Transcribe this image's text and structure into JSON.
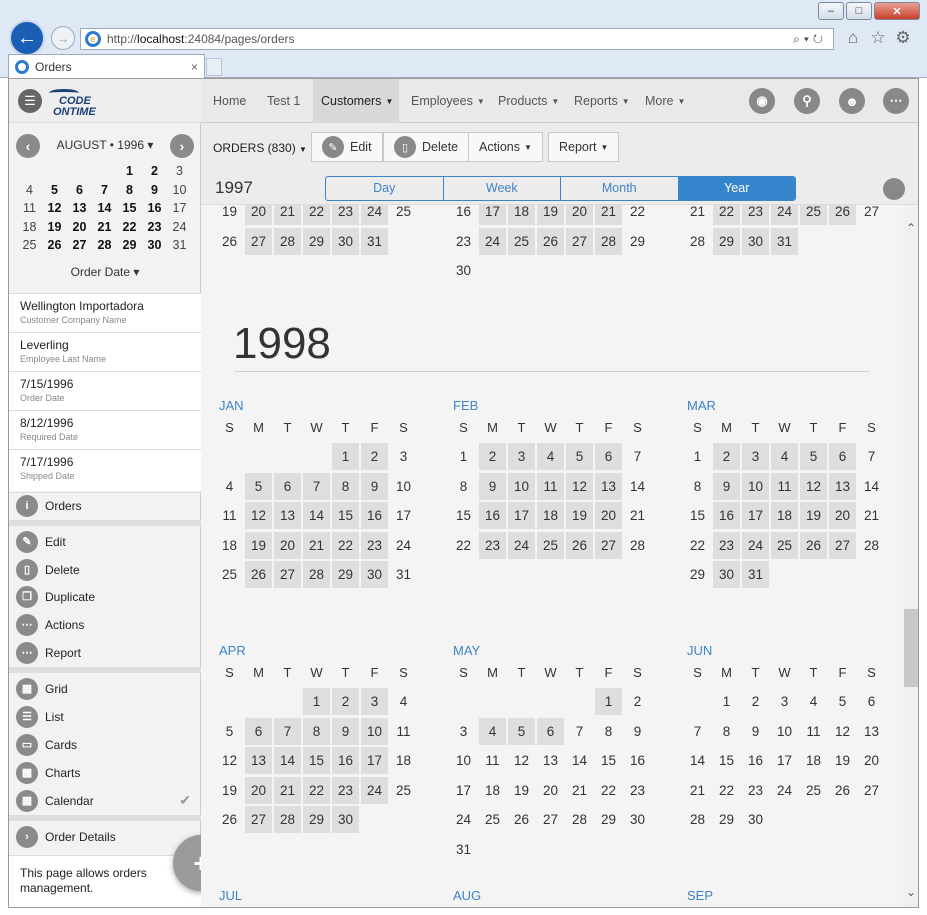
{
  "browser": {
    "url_prefix": "http://",
    "url_host": "localhost",
    "url_rest": ":24084/pages/orders",
    "tab_title": "Orders",
    "window_buttons": [
      "–",
      "□",
      "✕"
    ]
  },
  "sidebar": {
    "mini_calendar": {
      "title": "AUGUST • 1996 ▾",
      "weeks": [
        [
          " ",
          " ",
          " ",
          " ",
          "1",
          "2",
          "3"
        ],
        [
          "4",
          "5",
          "6",
          "7",
          "8",
          "9",
          "10"
        ],
        [
          "11",
          "12",
          "13",
          "14",
          "15",
          "16",
          "17"
        ],
        [
          "18",
          "19",
          "20",
          "21",
          "22",
          "23",
          "24"
        ],
        [
          "25",
          "26",
          "27",
          "28",
          "29",
          "30",
          "31"
        ]
      ],
      "bold_days": [
        "1",
        "2",
        "5",
        "6",
        "7",
        "8",
        "9",
        "12",
        "13",
        "14",
        "15",
        "16",
        "19",
        "20",
        "21",
        "22",
        "23",
        "26",
        "27",
        "28",
        "29",
        "30"
      ],
      "footer": "Order Date ▾"
    },
    "fields": [
      {
        "value": "Wellington Importadora",
        "label": "Customer Company Name"
      },
      {
        "value": "Leverling",
        "label": "Employee Last Name"
      },
      {
        "value": "7/15/1996",
        "label": "Order Date"
      },
      {
        "value": "8/12/1996",
        "label": "Required Date"
      },
      {
        "value": "7/17/1996",
        "label": "Shipped Date"
      }
    ],
    "orders_link": "Orders",
    "actions": [
      "Edit",
      "Delete",
      "Duplicate",
      "Actions",
      "Report"
    ],
    "views": [
      "Grid",
      "List",
      "Cards",
      "Charts",
      "Calendar"
    ],
    "order_details": "Order Details",
    "info": "This page allows orders management."
  },
  "topnav": {
    "items": [
      "Home",
      "Test 1",
      "Customers",
      "Employees",
      "Products",
      "Reports",
      "More"
    ]
  },
  "toolbar": {
    "view_label": "ORDERS (830)",
    "edit": "Edit",
    "delete": "Delete",
    "actions": "Actions",
    "report": "Report"
  },
  "viewbar": {
    "year": "1997",
    "segments": [
      "Day",
      "Week",
      "Month",
      "Year"
    ],
    "active": "Year"
  },
  "calendar": {
    "weekday_letters": [
      "S",
      "M",
      "T",
      "W",
      "T",
      "F",
      "S"
    ],
    "year_heading": "1998",
    "prev_tail": [
      {
        "rows": [
          [
            "19",
            "20",
            "21",
            "22",
            "23",
            "24",
            "25"
          ],
          [
            "26",
            "27",
            "28",
            "29",
            "30",
            "31",
            ""
          ]
        ],
        "highlight": [
          "20",
          "21",
          "22",
          "23",
          "24",
          "27",
          "28",
          "29",
          "30",
          "31"
        ]
      },
      {
        "rows": [
          [
            "16",
            "17",
            "18",
            "19",
            "20",
            "21",
            "22"
          ],
          [
            "23",
            "24",
            "25",
            "26",
            "27",
            "28",
            "29"
          ],
          [
            "30",
            "",
            "",
            "",
            "",
            "",
            ""
          ]
        ],
        "highlight": [
          "17",
          "18",
          "19",
          "20",
          "21",
          "24",
          "25",
          "26",
          "27",
          "28"
        ]
      },
      {
        "rows": [
          [
            "21",
            "22",
            "23",
            "24",
            "25",
            "26",
            "27"
          ],
          [
            "28",
            "29",
            "30",
            "31",
            "",
            "",
            ""
          ]
        ],
        "highlight": [
          "22",
          "23",
          "24",
          "25",
          "26",
          "29",
          "30",
          "31"
        ]
      }
    ],
    "months": [
      {
        "name": "JAN",
        "rows": [
          [
            "",
            "",
            "",
            "",
            "1",
            "2",
            "3"
          ],
          [
            "4",
            "5",
            "6",
            "7",
            "8",
            "9",
            "10"
          ],
          [
            "11",
            "12",
            "13",
            "14",
            "15",
            "16",
            "17"
          ],
          [
            "18",
            "19",
            "20",
            "21",
            "22",
            "23",
            "24"
          ],
          [
            "25",
            "26",
            "27",
            "28",
            "29",
            "30",
            "31"
          ]
        ],
        "highlight": [
          "1",
          "2",
          "5",
          "6",
          "7",
          "8",
          "9",
          "12",
          "13",
          "14",
          "15",
          "16",
          "19",
          "20",
          "21",
          "22",
          "23",
          "26",
          "27",
          "28",
          "29",
          "30"
        ]
      },
      {
        "name": "FEB",
        "rows": [
          [
            "1",
            "2",
            "3",
            "4",
            "5",
            "6",
            "7"
          ],
          [
            "8",
            "9",
            "10",
            "11",
            "12",
            "13",
            "14"
          ],
          [
            "15",
            "16",
            "17",
            "18",
            "19",
            "20",
            "21"
          ],
          [
            "22",
            "23",
            "24",
            "25",
            "26",
            "27",
            "28"
          ]
        ],
        "highlight": [
          "2",
          "3",
          "4",
          "5",
          "6",
          "9",
          "10",
          "11",
          "12",
          "13",
          "16",
          "17",
          "18",
          "19",
          "20",
          "23",
          "24",
          "25",
          "26",
          "27"
        ]
      },
      {
        "name": "MAR",
        "rows": [
          [
            "1",
            "2",
            "3",
            "4",
            "5",
            "6",
            "7"
          ],
          [
            "8",
            "9",
            "10",
            "11",
            "12",
            "13",
            "14"
          ],
          [
            "15",
            "16",
            "17",
            "18",
            "19",
            "20",
            "21"
          ],
          [
            "22",
            "23",
            "24",
            "25",
            "26",
            "27",
            "28"
          ],
          [
            "29",
            "30",
            "31",
            "",
            "",
            "",
            ""
          ]
        ],
        "highlight": [
          "2",
          "3",
          "4",
          "5",
          "6",
          "9",
          "10",
          "11",
          "12",
          "13",
          "16",
          "17",
          "18",
          "19",
          "20",
          "23",
          "24",
          "25",
          "26",
          "27",
          "30",
          "31"
        ]
      },
      {
        "name": "APR",
        "rows": [
          [
            "",
            "",
            "",
            "1",
            "2",
            "3",
            "4"
          ],
          [
            "5",
            "6",
            "7",
            "8",
            "9",
            "10",
            "11"
          ],
          [
            "12",
            "13",
            "14",
            "15",
            "16",
            "17",
            "18"
          ],
          [
            "19",
            "20",
            "21",
            "22",
            "23",
            "24",
            "25"
          ],
          [
            "26",
            "27",
            "28",
            "29",
            "30",
            "",
            ""
          ]
        ],
        "highlight": [
          "1",
          "2",
          "3",
          "6",
          "7",
          "8",
          "9",
          "10",
          "13",
          "14",
          "15",
          "16",
          "17",
          "20",
          "21",
          "22",
          "23",
          "24",
          "27",
          "28",
          "29",
          "30"
        ]
      },
      {
        "name": "MAY",
        "rows": [
          [
            "",
            "",
            "",
            "",
            "",
            "1",
            "2"
          ],
          [
            "3",
            "4",
            "5",
            "6",
            "7",
            "8",
            "9"
          ],
          [
            "10",
            "11",
            "12",
            "13",
            "14",
            "15",
            "16"
          ],
          [
            "17",
            "18",
            "19",
            "20",
            "21",
            "22",
            "23"
          ],
          [
            "24",
            "25",
            "26",
            "27",
            "28",
            "29",
            "30"
          ],
          [
            "31",
            "",
            "",
            "",
            "",
            "",
            ""
          ]
        ],
        "highlight": [
          "1",
          "4",
          "5",
          "6"
        ]
      },
      {
        "name": "JUN",
        "rows": [
          [
            "",
            "1",
            "2",
            "3",
            "4",
            "5",
            "6"
          ],
          [
            "7",
            "8",
            "9",
            "10",
            "11",
            "12",
            "13"
          ],
          [
            "14",
            "15",
            "16",
            "17",
            "18",
            "19",
            "20"
          ],
          [
            "21",
            "22",
            "23",
            "24",
            "25",
            "26",
            "27"
          ],
          [
            "28",
            "29",
            "30",
            "",
            "",
            "",
            ""
          ]
        ],
        "highlight": []
      }
    ],
    "next_months": [
      "JUL",
      "AUG",
      "SEP"
    ]
  }
}
